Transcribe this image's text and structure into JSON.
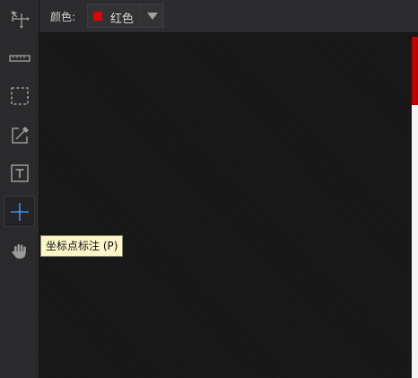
{
  "toolbar": {
    "tools": [
      {
        "icon": "move-icon"
      },
      {
        "icon": "ruler-icon"
      },
      {
        "icon": "marquee-select-icon"
      },
      {
        "icon": "eyedropper-icon"
      },
      {
        "icon": "text-icon"
      },
      {
        "icon": "crosshair-icon",
        "active": true
      },
      {
        "icon": "hand-icon"
      }
    ]
  },
  "topbar": {
    "color_label": "颜色:",
    "color_value": "红色",
    "color_swatch": "#e00000",
    "dropdown_icon": "triangle-down-icon"
  },
  "tooltip": {
    "text": "坐标点标注 (P)"
  },
  "colors": {
    "accent_blue": "#3a8ee6",
    "toolbar_bg": "#2a2a2c",
    "canvas_bg": "#171717",
    "document_red": "#c00000"
  }
}
